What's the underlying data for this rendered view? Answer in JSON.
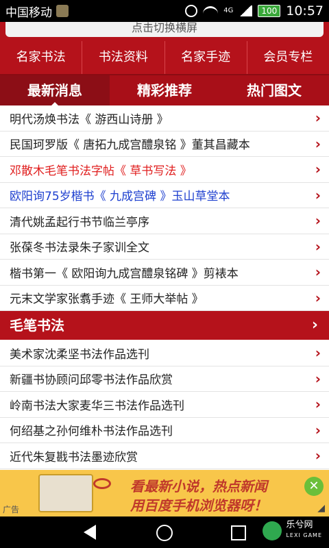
{
  "status": {
    "carrier": "中国移动",
    "network": "4G",
    "battery": "100",
    "time": "10:57"
  },
  "topbar": {
    "text": "点击切换横屏"
  },
  "categories": [
    "名家书法",
    "书法资料",
    "名家手迹",
    "会员专栏"
  ],
  "tabs": [
    "最新消息",
    "精彩推荐",
    "热门图文"
  ],
  "latest": [
    {
      "text": "明代汤焕书法《 游西山诗册 》",
      "color": "#222222"
    },
    {
      "text": "民国珂罗版《 唐拓九成宫醴泉铭 》董其昌藏本",
      "color": "#222222"
    },
    {
      "text": "邓散木毛笔书法字帖《 草书写法 》",
      "color": "#e01e1e"
    },
    {
      "text": "欧阳询75岁楷书《 九成宫碑 》玉山草堂本",
      "color": "#1d3fcf"
    },
    {
      "text": "清代姚孟起行书节临兰亭序",
      "color": "#222222"
    },
    {
      "text": "张葆冬书法录朱子家训全文",
      "color": "#222222"
    },
    {
      "text": "楷书第一《 欧阳询九成宫醴泉铭碑 》剪裱本",
      "color": "#222222"
    },
    {
      "text": "元末文学家张翥手迹《 王师大举帖 》",
      "color": "#222222"
    }
  ],
  "section": {
    "title": "毛笔书法"
  },
  "brush": [
    "美术家沈柔坚书法作品选刊",
    "新疆书协顾问邱零书法作品欣赏",
    "岭南书法大家麦华三书法作品选刊",
    "何绍基之孙何维朴书法作品选刊",
    "近代朱复戡书法墨迹欣赏"
  ],
  "ad": {
    "line1": "看最新小说，热点新闻",
    "line2": "用百度手机浏览器呀！",
    "label": "广告"
  },
  "watermark": {
    "name": "乐兮网",
    "sub": "LEXI GAME"
  },
  "icons": {
    "chevron": "›",
    "close": "✕"
  }
}
